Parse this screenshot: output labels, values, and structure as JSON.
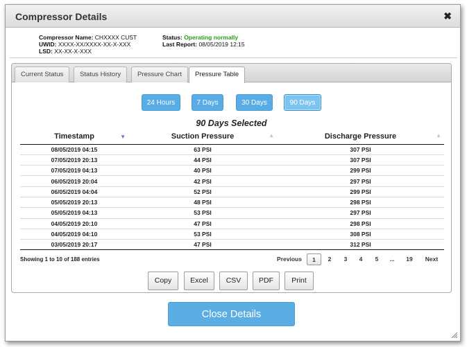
{
  "dialog": {
    "title": "Compressor Details",
    "close_glyph": "✖",
    "close_icon": "close-icon"
  },
  "info": {
    "compressor_name_label": "Compressor Name:",
    "compressor_name_value": "CHXXXX CUST",
    "uwid_label": "UWID:",
    "uwid_value": "XXXX-XX/XXXX-XX-X-XXX",
    "lsd_label": "LSD:",
    "lsd_value": "XX-XX-X-XXX",
    "status_label": "Status:",
    "status_value": "Operating normally",
    "last_report_label": "Last Report:",
    "last_report_value": "08/05/2019 12:15",
    "status_color": "#2a9a1a"
  },
  "tabs": [
    {
      "label": "Current Status"
    },
    {
      "label": "Status History"
    },
    {
      "label": "Pressure Chart"
    },
    {
      "label": "Pressure Table",
      "active": true
    }
  ],
  "ranges": [
    {
      "label": "24 Hours"
    },
    {
      "label": "7 Days"
    },
    {
      "label": "30 Days"
    },
    {
      "label": "90 Days",
      "selected": true
    }
  ],
  "selected_label": "90 Days Selected",
  "table": {
    "columns": [
      "Timestamp",
      "Suction Pressure",
      "Discharge Pressure"
    ],
    "rows": [
      [
        "08/05/2019 04:15",
        "63 PSI",
        "307 PSI"
      ],
      [
        "07/05/2019 20:13",
        "44 PSI",
        "307 PSI"
      ],
      [
        "07/05/2019 04:13",
        "40 PSI",
        "299 PSI"
      ],
      [
        "06/05/2019 20:04",
        "42 PSI",
        "297 PSI"
      ],
      [
        "06/05/2019 04:04",
        "52 PSI",
        "299 PSI"
      ],
      [
        "05/05/2019 20:13",
        "48 PSI",
        "298 PSI"
      ],
      [
        "05/05/2019 04:13",
        "53 PSI",
        "297 PSI"
      ],
      [
        "04/05/2019 20:10",
        "47 PSI",
        "298 PSI"
      ],
      [
        "04/05/2019 04:10",
        "53 PSI",
        "308 PSI"
      ],
      [
        "03/05/2019 20:17",
        "47 PSI",
        "312 PSI"
      ]
    ]
  },
  "showing_text": "Showing 1 to 10 of 188 entries",
  "pagination": {
    "previous": "Previous",
    "pages": [
      "1",
      "2",
      "3",
      "4",
      "5",
      "...",
      "19"
    ],
    "next": "Next",
    "current": "1"
  },
  "export_buttons": [
    "Copy",
    "Excel",
    "CSV",
    "PDF",
    "Print"
  ],
  "close_details": "Close Details",
  "colors": {
    "accent_blue": "#5aace6",
    "selected_blue": "#7cc4f2"
  }
}
